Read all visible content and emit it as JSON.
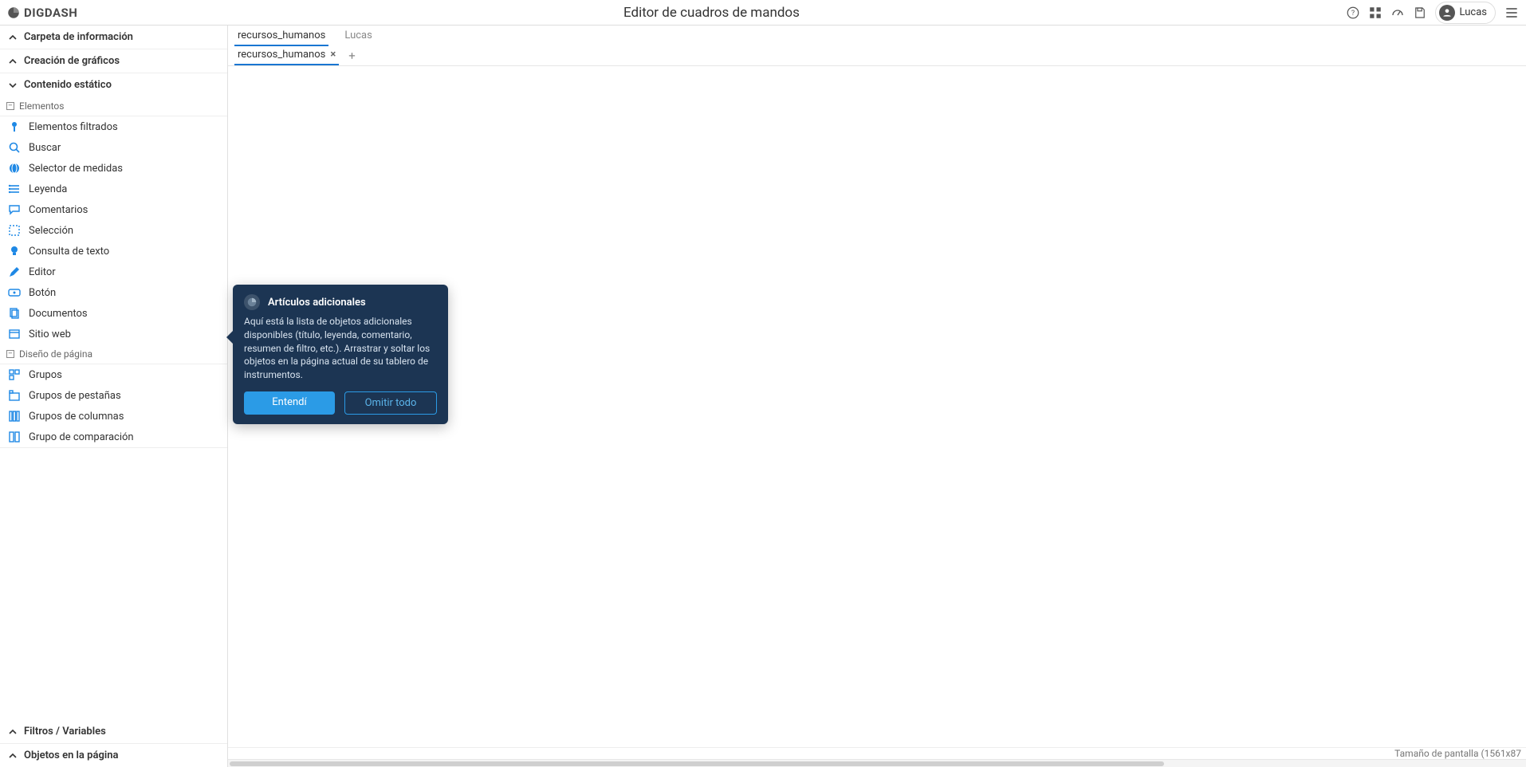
{
  "header": {
    "brand": "DIGDASH",
    "title": "Editor de cuadros de mandos",
    "user": "Lucas"
  },
  "sidebar": {
    "sections": {
      "info_folder": "Carpeta de información",
      "charts": "Creación de gráficos",
      "static_content": "Contenido estático",
      "filters_vars": "Filtros / Variables",
      "page_objects": "Objetos en la página"
    },
    "groups": {
      "elements": "Elementos",
      "page_design": "Diseño de página"
    },
    "items": {
      "filtered_elements": "Elementos filtrados",
      "search": "Buscar",
      "measure_selector": "Selector de medidas",
      "legend": "Leyenda",
      "comments": "Comentarios",
      "selection": "Selección",
      "text_query": "Consulta de texto",
      "editor": "Editor",
      "button": "Botón",
      "documents": "Documentos",
      "website": "Sitio web",
      "groups": "Grupos",
      "tab_groups": "Grupos de pestañas",
      "column_groups": "Grupos de columnas",
      "compare_group": "Grupo de comparación"
    }
  },
  "tabs": {
    "primary": [
      {
        "label": "recursos_humanos",
        "active": true
      },
      {
        "label": "Lucas",
        "active": false
      }
    ],
    "secondary": [
      {
        "label": "recursos_humanos"
      }
    ],
    "add": "+"
  },
  "tooltip": {
    "title": "Artículos adicionales",
    "body": "Aquí está la lista de objetos adicionales disponibles (título, leyenda, comentario, resumen de filtro, etc.). Arrastrar y soltar los objetos en la página actual de su tablero de instrumentos.",
    "primary": "Entendí",
    "secondary": "Omitir todo"
  },
  "status": {
    "text": "Tamaño de pantalla (1561x87"
  }
}
